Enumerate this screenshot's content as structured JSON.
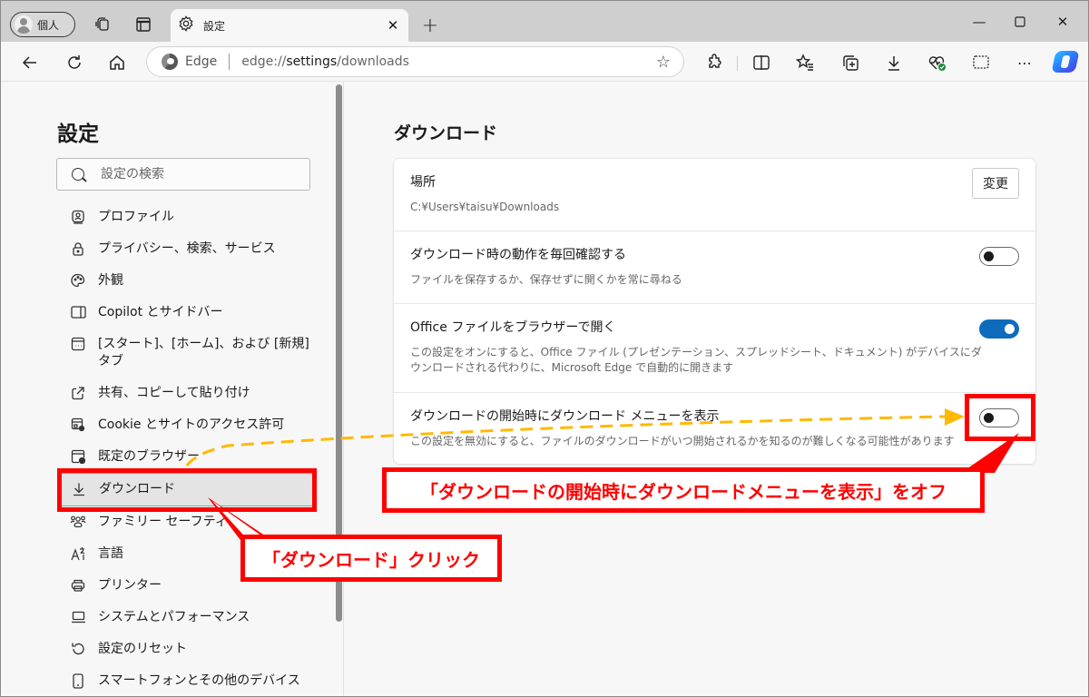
{
  "browser": {
    "profile_label": "個人",
    "tab_title": "設定",
    "site_name": "Edge",
    "url_prefix": "edge://",
    "url_host": "settings",
    "url_path": "/downloads"
  },
  "sidebar": {
    "title": "設定",
    "search_placeholder": "設定の検索",
    "items": [
      {
        "label": "プロファイル",
        "icon": "profile-icon"
      },
      {
        "label": "プライバシー、検索、サービス",
        "icon": "lock-icon"
      },
      {
        "label": "外観",
        "icon": "palette-icon"
      },
      {
        "label": "Copilot とサイドバー",
        "icon": "sidebar-icon"
      },
      {
        "label": "[スタート]、[ホーム]、および [新規] タブ",
        "icon": "new-tab-page-icon"
      },
      {
        "label": "共有、コピーして貼り付け",
        "icon": "share-icon"
      },
      {
        "label": "Cookie とサイトのアクセス許可",
        "icon": "site-permissions-icon"
      },
      {
        "label": "既定のブラウザー",
        "icon": "default-browser-icon"
      },
      {
        "label": "ダウンロード",
        "icon": "download-icon",
        "selected": true
      },
      {
        "label": "ファミリー セーフティ",
        "icon": "family-icon"
      },
      {
        "label": "言語",
        "icon": "language-icon"
      },
      {
        "label": "プリンター",
        "icon": "printer-icon"
      },
      {
        "label": "システムとパフォーマンス",
        "icon": "laptop-icon"
      },
      {
        "label": "設定のリセット",
        "icon": "reset-icon"
      },
      {
        "label": "スマートフォンとその他のデバイス",
        "icon": "phone-icon"
      }
    ]
  },
  "main": {
    "title": "ダウンロード",
    "settings": [
      {
        "title": "場所",
        "desc": "C:¥Users¥taisu¥Downloads",
        "control": "button",
        "button_label": "変更"
      },
      {
        "title": "ダウンロード時の動作を毎回確認する",
        "desc": "ファイルを保存するか、保存せずに開くかを常に尋ねる",
        "control": "toggle",
        "on": false
      },
      {
        "title": "Office ファイルをブラウザーで開く",
        "desc": "この設定をオンにすると、Office ファイル (プレゼンテーション、スプレッドシート、ドキュメント) がデバイスにダウンロードされる代わりに、Microsoft Edge で自動的に開きます",
        "control": "toggle",
        "on": true
      },
      {
        "title": "ダウンロードの開始時にダウンロード メニューを表示",
        "desc": "この設定を無効にすると、ファイルのダウンロードがいつ開始されるかを知るのが難しくなる可能性があります",
        "control": "toggle",
        "on": false
      }
    ]
  },
  "annotations": {
    "callout_toggle": "「ダウンロードの開始時にダウンロードメニューを表示」をオフ",
    "callout_sidebar": "「ダウンロード」クリック",
    "red": "#ff0000",
    "arrow_color": "#ffb900"
  },
  "colors": {
    "accent": "#0f6cbd"
  }
}
